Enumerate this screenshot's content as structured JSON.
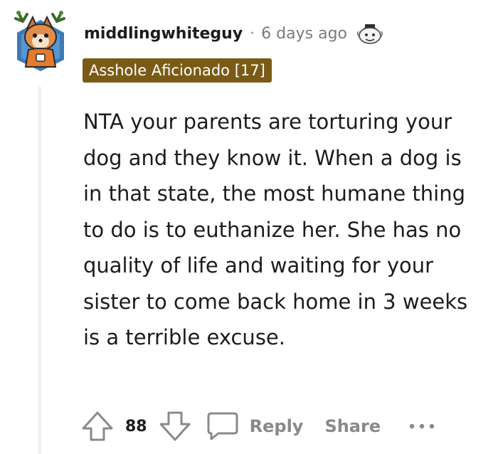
{
  "comment": {
    "username": "middlingwhiteguy",
    "separator": "·",
    "time_ago": "6 days ago",
    "flair": "Asshole Aficionado [17]",
    "body": "NTA your parents are torturing your dog and they know it. When a dog is in that state, the most humane thing to do is to euthanize her. She has no quality of life and waiting for your sister to come back home in 3 weeks is a terrible excuse.",
    "icons": {
      "avatar": "user-avatar-fox-icon",
      "award": "award-icon",
      "upvote": "upvote-arrow-icon",
      "downvote": "downvote-arrow-icon",
      "reply": "speech-bubble-icon",
      "more": "more-options-icon"
    }
  },
  "actions": {
    "vote_count": "88",
    "reply_label": "Reply",
    "share_label": "Share",
    "more_label": "···"
  },
  "colors": {
    "flair_bg": "#7a5b16",
    "muted": "#878a8c",
    "thread_line": "#edeff1",
    "avatar_bg": "#3e7ab7"
  }
}
